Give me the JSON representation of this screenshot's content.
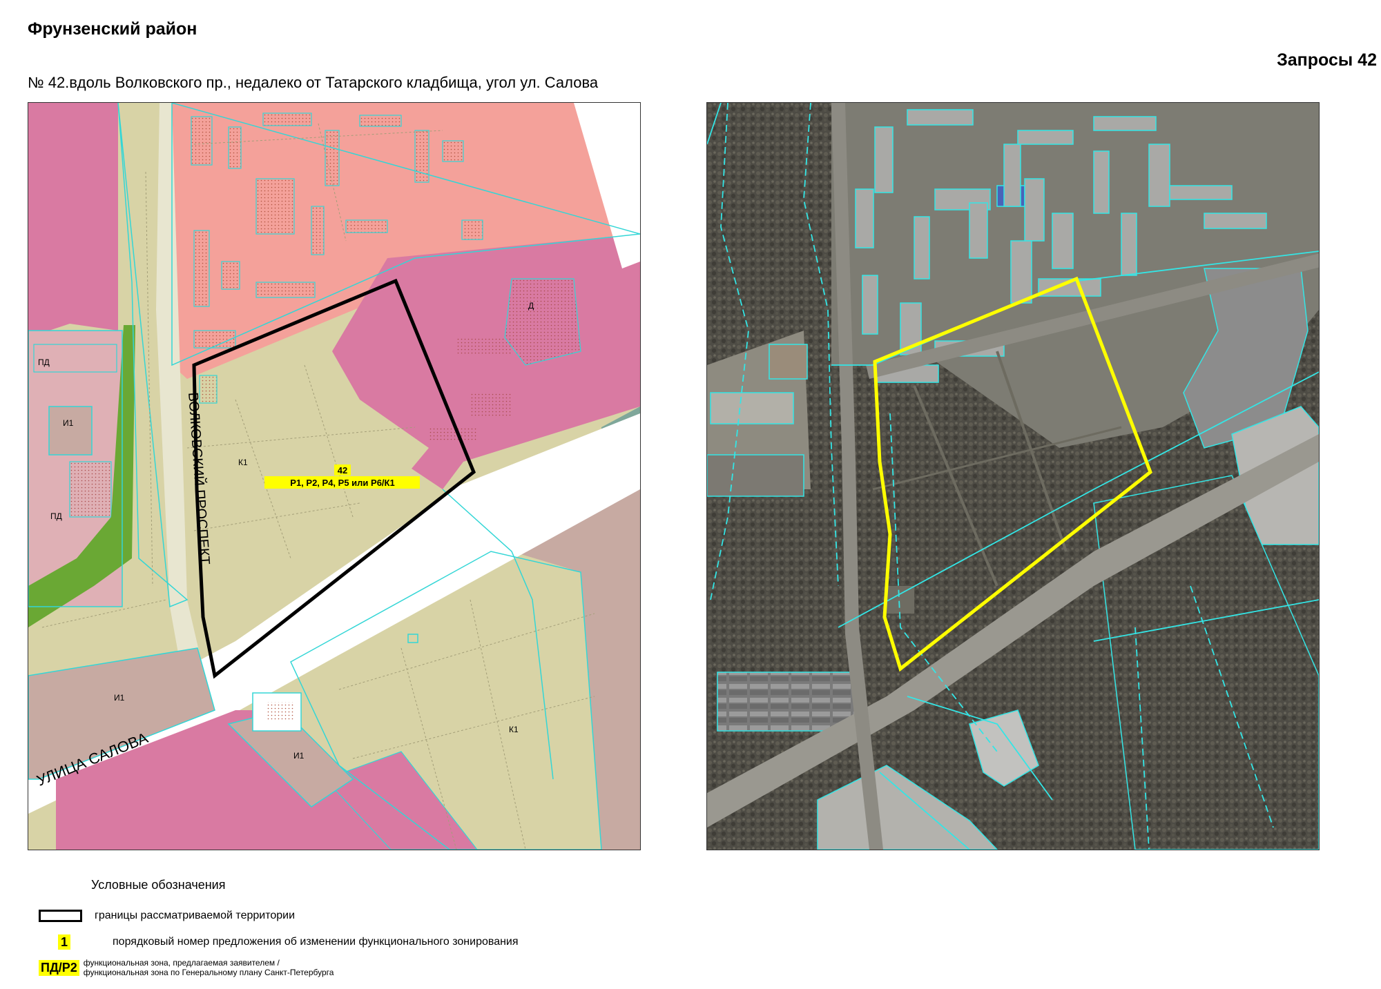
{
  "header": {
    "district": "Фрунзенский район",
    "request_label": "Запросы 42",
    "site_caption": "№ 42.вдоль Волковского пр., недалеко от Татарского кладбища, угол ул. Салова"
  },
  "zoning_map": {
    "street_labels": {
      "volkovsky": "ВОЛКОВСКИЙ ПРОСПЕКТ",
      "salova": "УЛИЦА САЛОВА"
    },
    "zone_labels": {
      "pd_upper": "ПД",
      "i1_left": "И1",
      "pd_lower": "ПД",
      "k1_site": "К1",
      "d": "Д",
      "i1_bottom_left": "И1",
      "i1_bottom_mid": "И1",
      "k1_lower": "К1"
    },
    "proposal": {
      "number": "42",
      "zones": "Р1, Р2, Р4, Р5 или Р6/К1"
    },
    "colors": {
      "residential": "#f4a19a",
      "cemetery": "#d8d3a6",
      "public": "#d97aa2",
      "park": "#6aa834",
      "industrial": "#c7aaa2",
      "road": "#ffffff",
      "parcel_outline": "#33d6d6",
      "boundary": "#000000",
      "label_highlight": "#ffff00"
    }
  },
  "aerial_map": {
    "colors": {
      "boundary": "#ffff00",
      "parcel_outline": "#33e6e6"
    }
  },
  "legend": {
    "title": "Условные обозначения",
    "boundary": "границы рассматриваемой территории",
    "number_swatch": "1",
    "number": "порядковый номер предложения об изменении функционального зонирования",
    "zone_swatch": "ПД/Р2",
    "zone_line1": "функциональная зона, предлагаемая заявителем /",
    "zone_line2": "функциональная зона по Генеральному плану Санкт-Петербурга"
  }
}
